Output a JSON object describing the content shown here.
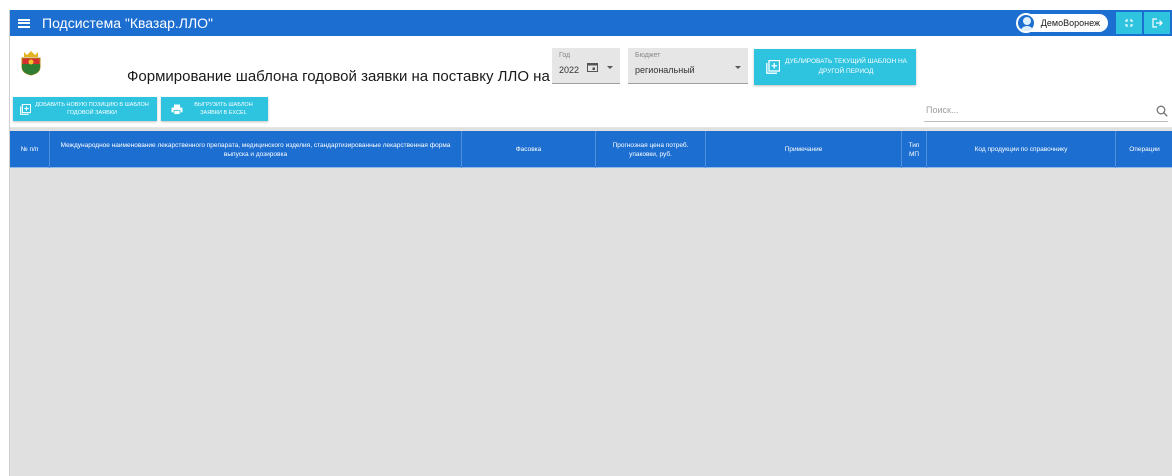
{
  "app": {
    "title": "Подсистема \"Квазар.ЛЛО\"",
    "user_name": "ДемоВоронеж"
  },
  "header": {
    "title": "Формирование шаблона годовой заявки на поставку ЛЛО на",
    "year": {
      "label": "Год",
      "value": "2022"
    },
    "budget": {
      "label": "Бюджет",
      "value": "региональный"
    },
    "duplicate_button": "ДУБЛИРОВАТЬ ТЕКУЩИЙ ШАБЛОН НА ДРУГОЙ ПЕРИОД"
  },
  "toolbar": {
    "add_button": "ДОБАВИТЬ НОВУЮ ПОЗИЦИЮ В ШАБЛОН ГОДОВОЙ ЗАЯВКИ",
    "export_button": "ВЫГРУЗИТЬ ШАБЛОН ЗАЯВКИ В EXCEL",
    "search_placeholder": "Поиск..."
  },
  "table": {
    "columns": [
      "№ п/п",
      "Международное наименование лекарственного препарата, медицинского изделия, стандартизированные лекарственная форма выпуска и дозировка",
      "Фасовка",
      "Прогнозная цена потреб. упаковки, руб.",
      "Примечание",
      "Тип МП",
      "Код продукции по справочнику",
      "Операции"
    ],
    "rows": []
  },
  "icons": {
    "menu": "hamburger-icon",
    "user": "user-avatar-icon",
    "fullscreen": "fullscreen-icon",
    "logout": "logout-icon",
    "emblem": "region-emblem-icon",
    "calendar": "calendar-icon",
    "add": "add-box-icon",
    "print": "print-icon",
    "search": "search-icon"
  },
  "colors": {
    "primary": "#1c6fd1",
    "accent": "#2ec4e0",
    "background": "#e0e0e0"
  }
}
